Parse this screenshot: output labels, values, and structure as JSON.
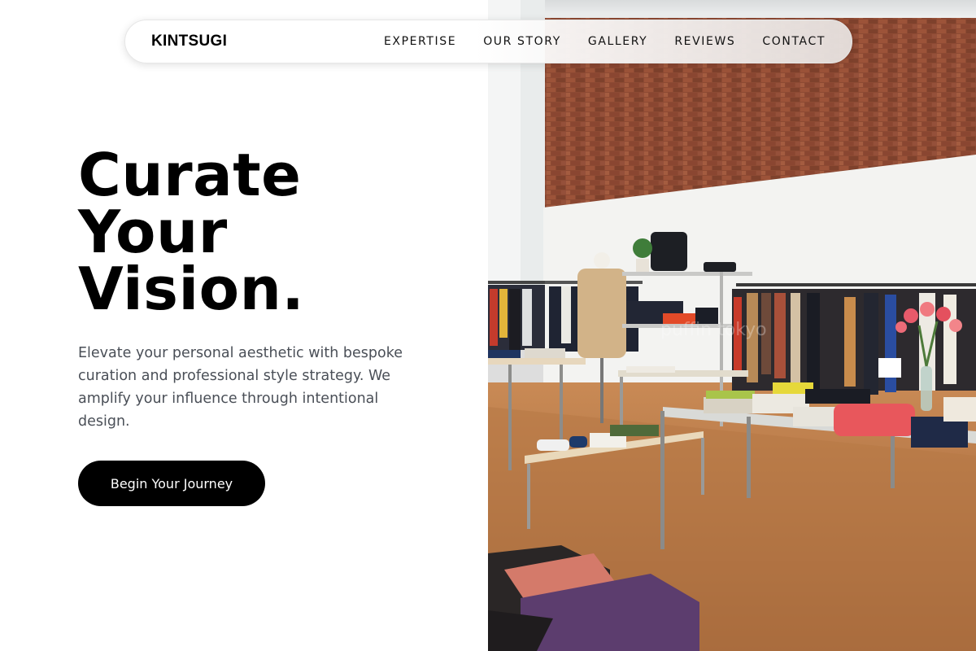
{
  "nav": {
    "brand": "KINTSUGI",
    "links": [
      "EXPERTISE",
      "OUR STORY",
      "GALLERY",
      "REVIEWS",
      "CONTACT"
    ]
  },
  "hero": {
    "title_lines": [
      "Curate",
      "Your",
      "Vision."
    ],
    "description": "Elevate your personal aesthetic with bespoke curation and professional style strategy. We amplify your influence through intentional design.",
    "cta_label": "Begin Your Journey"
  },
  "image": {
    "alt": "Boutique clothing store interior",
    "watermark": "puffin tokyo"
  },
  "colors": {
    "cta_background": "#000000",
    "cta_text": "#ffffff",
    "body_text": "#4a4f57",
    "heading": "#000000"
  }
}
